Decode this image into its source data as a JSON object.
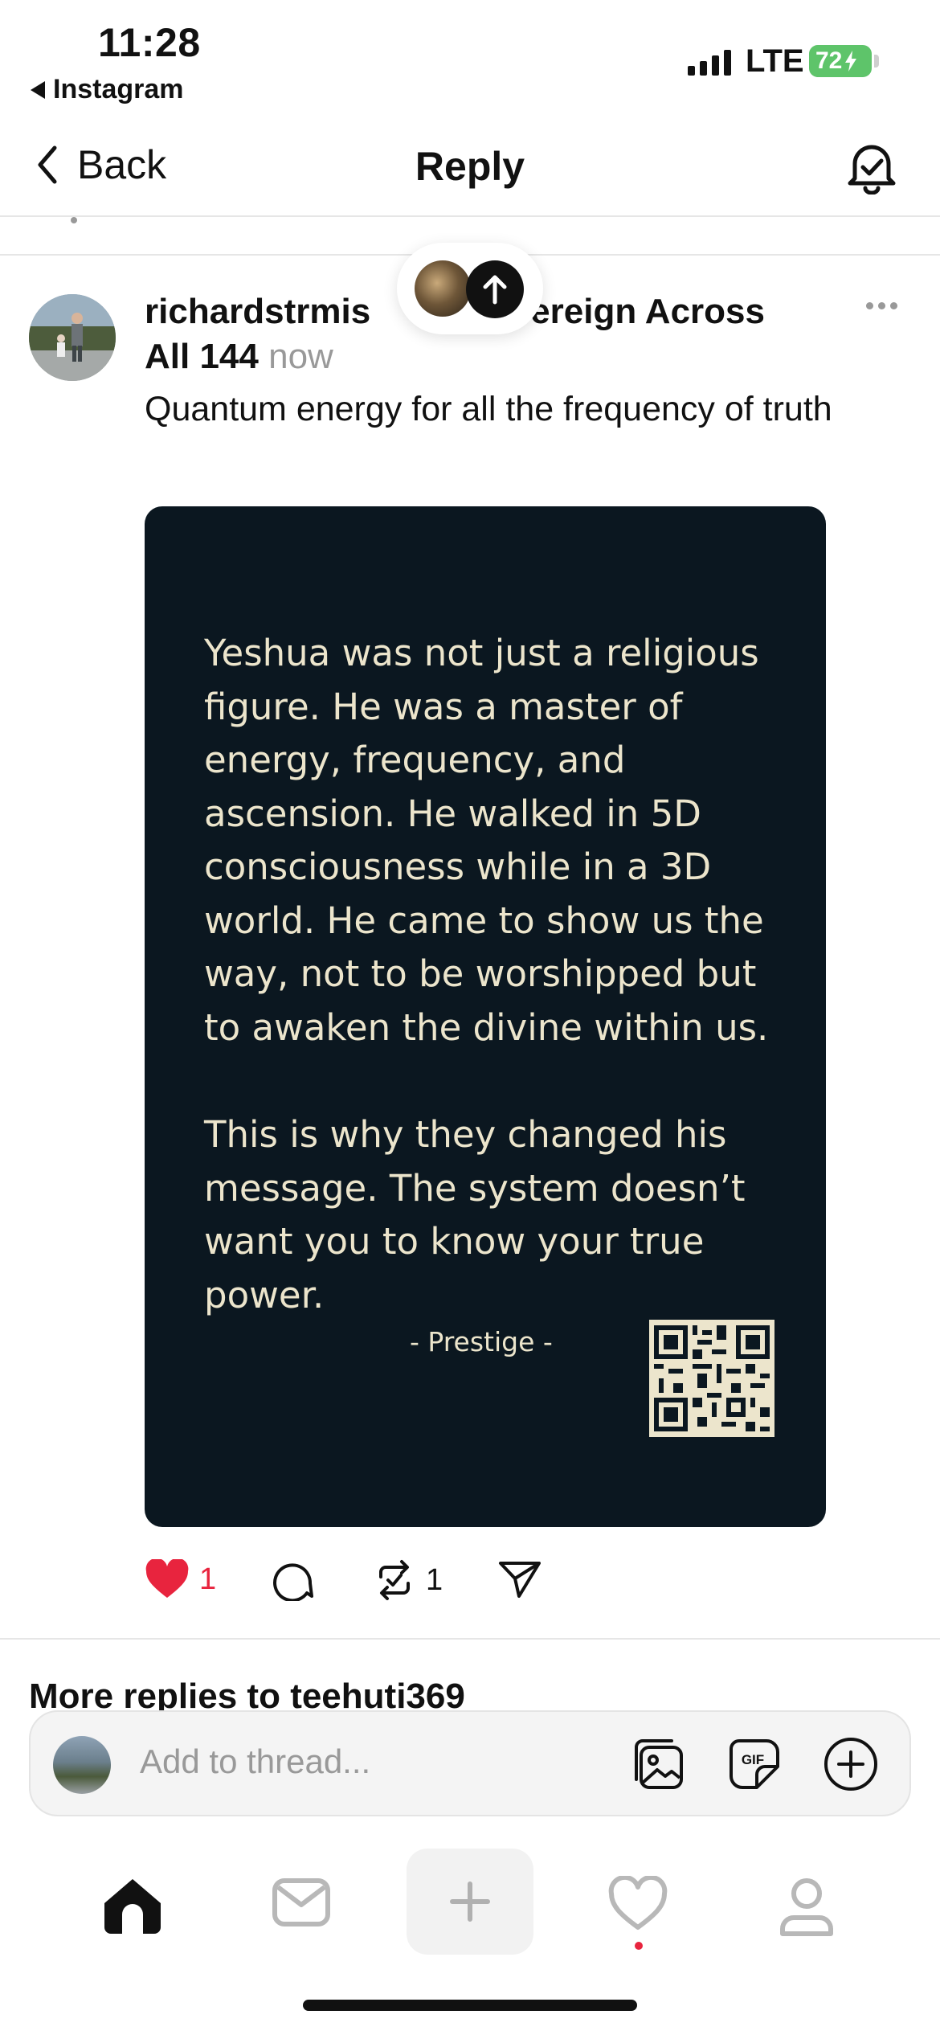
{
  "status_bar": {
    "time": "11:28",
    "back_app": "Instagram",
    "network": "LTE",
    "battery": "72"
  },
  "nav": {
    "back_label": "Back",
    "title": "Reply"
  },
  "post": {
    "username_line1": "richardstrmis",
    "username_suffix": "vereign Across",
    "username_line2": "All 144",
    "time_ago": "now",
    "text": "Quantum energy for all the frequency of truth",
    "image_quote": {
      "paragraph1": "Yeshua was not just a religious figure. He was a master of energy, frequency, and ascension. He walked in 5D consciousness while in a 3D world. He came to show us the way, not to be worshipped but to awaken the divine within us.",
      "paragraph2": "This is why they changed his message. The system doesn’t want you to know your true power.",
      "signature": "- Prestige -"
    },
    "actions": {
      "likes": "1",
      "reposts": "1"
    }
  },
  "more_replies_label": "More replies to teehuti369",
  "composer": {
    "placeholder": "Add to thread..."
  },
  "colors": {
    "accent_red": "#e8243e",
    "image_bg": "#0b1720",
    "image_text": "#ece5cc",
    "battery_green": "#5ec46a"
  },
  "icons": [
    "chevron-left-icon",
    "bell-check-icon",
    "arrow-up-icon",
    "more-icon",
    "heart-icon",
    "comment-icon",
    "repost-icon",
    "send-icon",
    "image-icon",
    "gif-icon",
    "plus-circle-icon",
    "home-icon",
    "inbox-icon",
    "plus-icon",
    "heart-outline-icon",
    "profile-icon"
  ]
}
